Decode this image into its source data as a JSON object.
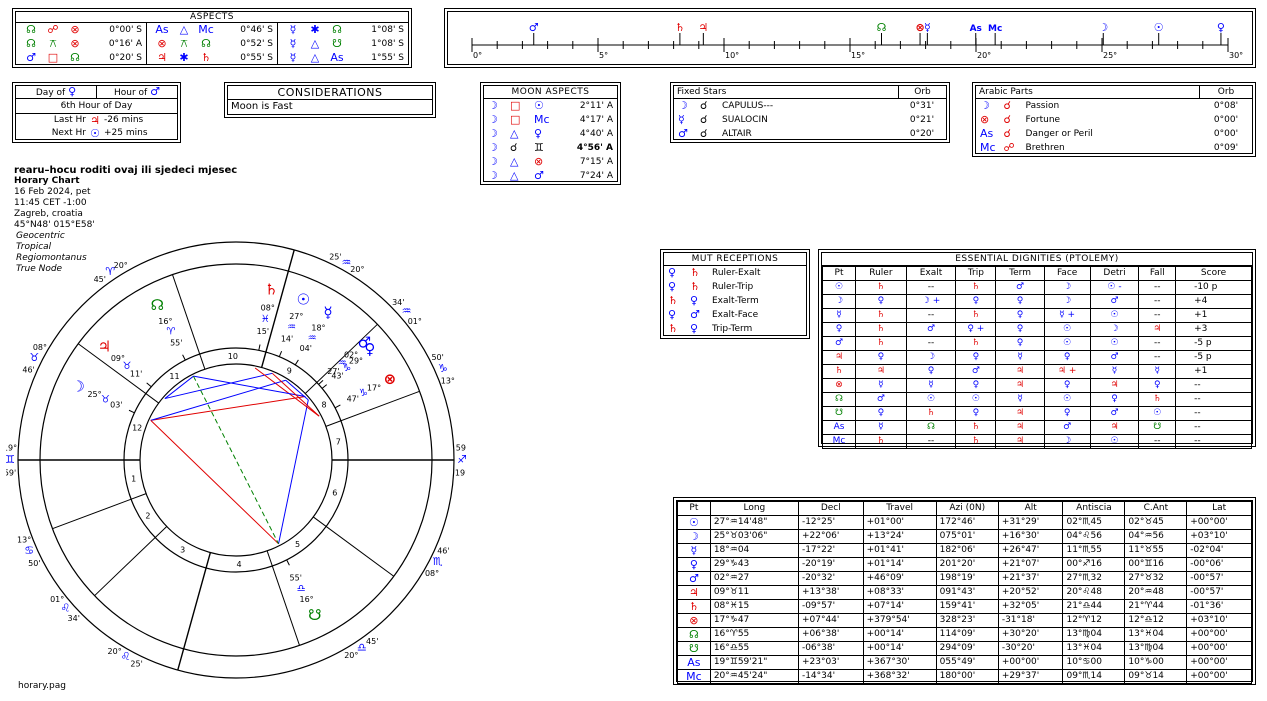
{
  "aspects": {
    "title": "ASPECTS",
    "groups": [
      [
        {
          "p1": "☊",
          "c1": "green",
          "asp": "☍",
          "ac": "red",
          "p2": "⊗",
          "c2": "red",
          "orb": "0°00' S"
        },
        {
          "p1": "☊",
          "c1": "green",
          "asp": "⚻",
          "ac": "green",
          "p2": "⊗",
          "c2": "red",
          "orb": "0°16' A"
        },
        {
          "p1": "♂",
          "c1": "blue",
          "asp": "□",
          "ac": "red",
          "p2": "☊",
          "c2": "green",
          "orb": "0°20' S"
        }
      ],
      [
        {
          "p1": "As",
          "c1": "blue",
          "asp": "△",
          "ac": "blue",
          "p2": "Mc",
          "c2": "blue",
          "orb": "0°46' S"
        },
        {
          "p1": "⊗",
          "c1": "red",
          "asp": "⚻",
          "ac": "green",
          "p2": "☊",
          "c2": "green",
          "orb": "0°52' S"
        },
        {
          "p1": "♃",
          "c1": "red",
          "asp": "✱",
          "ac": "blue",
          "p2": "♄",
          "c2": "red",
          "orb": "0°55' S"
        }
      ],
      [
        {
          "p1": "☿",
          "c1": "blue",
          "asp": "✱",
          "ac": "blue",
          "p2": "☊",
          "c2": "green",
          "orb": "1°08' S"
        },
        {
          "p1": "☿",
          "c1": "blue",
          "asp": "△",
          "ac": "blue",
          "p2": "☋",
          "c2": "green",
          "orb": "1°08' S"
        },
        {
          "p1": "☿",
          "c1": "blue",
          "asp": "△",
          "ac": "blue",
          "p2": "As",
          "c2": "blue",
          "orb": "1°55' S"
        }
      ]
    ]
  },
  "ruler": {
    "ticks": [
      "0°",
      "5°",
      "10°",
      "15°",
      "20°",
      "25°",
      "30°"
    ],
    "markers": [
      {
        "glyph": "♂",
        "deg": 2.45,
        "color": "#0000ff"
      },
      {
        "glyph": "♄",
        "deg": 8.25,
        "color": "#e00000"
      },
      {
        "glyph": "♃",
        "deg": 9.18,
        "color": "#e00000"
      },
      {
        "glyph": "☊",
        "deg": 16.25,
        "color": "#008000"
      },
      {
        "glyph": "⊗",
        "deg": 17.78,
        "color": "#e00000"
      },
      {
        "glyph": "☿",
        "deg": 18.07,
        "color": "#0000ff"
      },
      {
        "glyph": "As",
        "deg": 19.99,
        "color": "#0000ff"
      },
      {
        "glyph": "Mc",
        "deg": 20.76,
        "color": "#0000ff"
      },
      {
        "glyph": "☽",
        "deg": 25.05,
        "color": "#0000ff"
      },
      {
        "glyph": "☉",
        "deg": 27.25,
        "color": "#0000ff"
      },
      {
        "glyph": "♀",
        "deg": 29.72,
        "color": "#0000ff"
      }
    ]
  },
  "day_hour": {
    "day_of_label": "Day of",
    "day_planet": "♀",
    "hour_of_label": "Hour of",
    "hour_planet": "♂",
    "hour_text": "6th Hour of Day",
    "last_label": "Last Hr",
    "last_planet": "♃",
    "last_val": "-26 mins",
    "next_label": "Next Hr",
    "next_planet": "☉",
    "next_val": "+25 mins"
  },
  "considerations": {
    "title": "CONSIDERATIONS",
    "items": [
      "Moon is Fast"
    ]
  },
  "moon_aspects": {
    "title": "MOON ASPECTS",
    "rows": [
      {
        "a": "☽",
        "asp": "□",
        "ac": "red",
        "p": "☉",
        "pc": "blue",
        "orb": "2°11' A",
        "bold": false
      },
      {
        "a": "☽",
        "asp": "□",
        "ac": "red",
        "p": "Mc",
        "pc": "blue",
        "orb": "4°17' A",
        "bold": false
      },
      {
        "a": "☽",
        "asp": "△",
        "ac": "blue",
        "p": "♀",
        "pc": "blue",
        "orb": "4°40' A",
        "bold": false
      },
      {
        "a": "☽",
        "asp": "☌",
        "ac": "black",
        "p": "♊",
        "pc": "black",
        "orb": "4°56' A",
        "bold": true
      },
      {
        "a": "☽",
        "asp": "△",
        "ac": "blue",
        "p": "⊗",
        "pc": "red",
        "orb": "7°15' A",
        "bold": false
      },
      {
        "a": "☽",
        "asp": "△",
        "ac": "blue",
        "p": "♂",
        "pc": "blue",
        "orb": "7°24' A",
        "bold": false
      }
    ]
  },
  "fixed_stars": {
    "title": "Fixed Stars",
    "orb_label": "Orb",
    "rows": [
      {
        "p": "☽",
        "asp": "☌",
        "name": "CAPULUS---",
        "orb": "0°31'"
      },
      {
        "p": "☿",
        "asp": "☌",
        "name": "SUALOCIN",
        "orb": "0°21'"
      },
      {
        "p": "♂",
        "asp": "☌",
        "name": "ALTAIR",
        "orb": "0°20'"
      }
    ]
  },
  "arabic_parts": {
    "title": "Arabic Parts",
    "orb_label": "Orb",
    "rows": [
      {
        "p": "☽",
        "pc": "blue",
        "asp": "☌",
        "name": "Passion",
        "orb": "0°08'"
      },
      {
        "p": "⊗",
        "pc": "red",
        "asp": "☌",
        "name": "Fortune",
        "orb": "0°00'"
      },
      {
        "p": "As",
        "pc": "blue",
        "asp": "☌",
        "name": "Danger or Peril",
        "orb": "0°00'"
      },
      {
        "p": "Mc",
        "pc": "blue",
        "asp": "☍",
        "name": "Brethren",
        "orb": "0°09'"
      }
    ]
  },
  "header": {
    "question": "rearu–hocu roditi ovaj ili sjedeci mjesec",
    "chart_type": "Horary Chart",
    "date": "16 Feb 2024, pet",
    "time": "11:45  CET  -1:00",
    "place": "Zagreb, croatia",
    "coords": "45°N48' 015°E58'",
    "settings": [
      "Geocentric",
      "Tropical",
      "Regiomontanus",
      "True Node"
    ]
  },
  "mut_receptions": {
    "title": "MUT  RECEPTIONS",
    "rows": [
      {
        "a": "♀",
        "ac": "blue",
        "b": "♄",
        "bc": "red",
        "t": "Ruler-Exalt"
      },
      {
        "a": "♀",
        "ac": "blue",
        "b": "♄",
        "bc": "red",
        "t": "Ruler-Trip"
      },
      {
        "a": "♄",
        "ac": "red",
        "b": "♀",
        "bc": "blue",
        "t": "Exalt-Term"
      },
      {
        "a": "♀",
        "ac": "blue",
        "b": "♂",
        "bc": "blue",
        "t": "Exalt-Face"
      },
      {
        "a": "♄",
        "ac": "red",
        "b": "♀",
        "bc": "blue",
        "t": "Trip-Term"
      }
    ]
  },
  "dignities": {
    "title": "ESSENTIAL DIGNITIES (PTOLEMY)",
    "headers": [
      "Pt",
      "Ruler",
      "Exalt",
      "Trip",
      "Term",
      "Face",
      "Detri",
      "Fall",
      "Score"
    ],
    "rows": [
      [
        "☉",
        "♄",
        "--",
        "♄",
        "♂",
        "☽",
        "☉ -",
        "--",
        "-10  p"
      ],
      [
        "☽",
        "♀",
        "☽ +",
        "♀",
        "♀",
        "☽",
        "♂",
        "--",
        "+4"
      ],
      [
        "☿",
        "♄",
        "--",
        "♄",
        "♀",
        "☿ +",
        "☉",
        "--",
        "+1"
      ],
      [
        "♀",
        "♄",
        "♂",
        "♀ +",
        "♀",
        "☉",
        "☽",
        "♃",
        "+3"
      ],
      [
        "♂",
        "♄",
        "--",
        "♄",
        "♀",
        "☉",
        "☉",
        "--",
        "-5  p"
      ],
      [
        "♃",
        "♀",
        "☽",
        "♀",
        "☿",
        "♀",
        "♂",
        "--",
        "-5  p"
      ],
      [
        "♄",
        "♃",
        "♀",
        "♂",
        "♃",
        "♃ +",
        "☿",
        "☿",
        "+1"
      ],
      [
        "⊗",
        "☿",
        "☿",
        "♀",
        "♃",
        "♀",
        "♃",
        "♀",
        "--"
      ],
      [
        "☊",
        "♂",
        "☉",
        "☉",
        "☿",
        "☉",
        "♀",
        "♄",
        "--"
      ],
      [
        "☋",
        "♀",
        "♄",
        "♀",
        "♃",
        "♀",
        "♂",
        "☉",
        "--"
      ],
      [
        "As",
        "☿",
        "☊",
        "♄",
        "♃",
        "♂",
        "♃",
        "☋",
        "--"
      ],
      [
        "Mc",
        "♄",
        "--",
        "♄",
        "♃",
        "☽",
        "☉",
        "--",
        "--"
      ]
    ]
  },
  "positions": {
    "headers": [
      "Pt",
      "Long",
      "Decl",
      "Travel",
      "Azi (0N)",
      "Alt",
      "Antiscia",
      "C.Ant",
      "Lat"
    ],
    "rows": [
      [
        "☉",
        "27°♒14'48\"",
        "-12°25'",
        "+01°00'",
        "172°46'",
        "+31°29'",
        "02°♏45",
        "02°♉45",
        "+00°00'"
      ],
      [
        "☽",
        "25°♉03'06\"",
        "+22°06'",
        "+13°24'",
        "075°01'",
        "+16°30'",
        "04°♌56",
        "04°♒56",
        "+03°10'"
      ],
      [
        "☿",
        "18°♒04",
        "-17°22'",
        "+01°41'",
        "182°06'",
        "+26°47'",
        "11°♏55",
        "11°♉55",
        "-02°04'"
      ],
      [
        "♀",
        "29°♑43",
        "-20°19'",
        "+01°14'",
        "201°20'",
        "+21°07'",
        "00°♐16",
        "00°♊16",
        "-00°06'"
      ],
      [
        "♂",
        "02°♒27",
        "-20°32'",
        "+46°09'",
        "198°19'",
        "+21°37'",
        "27°♏32",
        "27°♉32",
        "-00°57'"
      ],
      [
        "♃",
        "09°♉11",
        "+13°38'",
        "+08°33'",
        "091°43'",
        "+20°52'",
        "20°♌48",
        "20°♒48",
        "-00°57'"
      ],
      [
        "♄",
        "08°♓15",
        "-09°57'",
        "+07°14'",
        "159°41'",
        "+32°05'",
        "21°♎44",
        "21°♈44",
        "-01°36'"
      ],
      [
        "⊗",
        "17°♑47",
        "+07°44'",
        "+379°54'",
        "328°23'",
        "-31°18'",
        "12°♈12",
        "12°♎12",
        "+03°10'"
      ],
      [
        "☊",
        "16°♈55",
        "+06°38'",
        "+00°14'",
        "114°09'",
        "+30°20'",
        "13°♍04",
        "13°♓04",
        "+00°00'"
      ],
      [
        "☋",
        "16°♎55",
        "-06°38'",
        "+00°14'",
        "294°09'",
        "-30°20'",
        "13°♓04",
        "13°♍04",
        "+00°00'"
      ],
      [
        "As",
        "19°♊59'21\"",
        "+23°03'",
        "+367°30'",
        "055°49'",
        "+00°00'",
        "10°♋00",
        "10°♑00",
        "+00°00'"
      ],
      [
        "Mc",
        "20°♒45'24\"",
        "-14°34'",
        "+368°32'",
        "180°00'",
        "+29°37'",
        "09°♏14",
        "09°♉14",
        "+00°00'"
      ]
    ]
  },
  "wheel": {
    "asc_deg": 79.99,
    "cusps": [
      79.99,
      100.5,
      123.8,
      154.5,
      188.9,
      223.6,
      259.99,
      280.5,
      303.8,
      334.5,
      8.9,
      43.6
    ],
    "house_numbers": [
      "1",
      "2",
      "3",
      "4",
      "5",
      "6",
      "7",
      "8",
      "9",
      "10",
      "11",
      "12"
    ],
    "cusp_labels": [
      {
        "lon": 79.99,
        "deg": "19°",
        "sign": "♊",
        "min": "59'"
      },
      {
        "lon": 259.99,
        "deg": "19°",
        "sign": "♐",
        "min": "59'"
      },
      {
        "lon": 320.75,
        "deg": "20°",
        "sign": "♒",
        "min": "25'"
      },
      {
        "lon": 140.75,
        "deg": "20°",
        "sign": "♌",
        "min": "25'"
      },
      {
        "lon": 23.8,
        "deg": "20°",
        "sign": "♈",
        "min": "45'"
      },
      {
        "lon": 203.8,
        "deg": "20°",
        "sign": "♎",
        "min": "45'"
      },
      {
        "lon": 53.2,
        "deg": "08°",
        "sign": "♉",
        "min": "46'"
      },
      {
        "lon": 233.2,
        "deg": "08°",
        "sign": "♏",
        "min": "46'"
      },
      {
        "lon": 103.8,
        "deg": "13°",
        "sign": "♋",
        "min": "50'"
      },
      {
        "lon": 283.8,
        "deg": "13°",
        "sign": "♑",
        "min": "50'"
      },
      {
        "lon": 121.0,
        "deg": "01°",
        "sign": "♌",
        "min": "34'"
      },
      {
        "lon": 301.0,
        "deg": "01°",
        "sign": "♒",
        "min": "34'"
      }
    ],
    "planets": [
      {
        "glyph": "☉",
        "lon": 327.25,
        "color": "#0000ff",
        "deg": "27°",
        "sign": "♒",
        "min": "14'"
      },
      {
        "glyph": "☿",
        "lon": 318.07,
        "color": "#0000ff",
        "deg": "18°",
        "sign": "♒",
        "min": "04'"
      },
      {
        "glyph": "♂",
        "lon": 302.45,
        "color": "#0000ff",
        "deg": "02°",
        "sign": "♒",
        "min": "27'"
      },
      {
        "glyph": "♀",
        "lon": 299.72,
        "color": "#0000ff",
        "deg": "29°",
        "sign": "♑",
        "min": "43'"
      },
      {
        "glyph": "♄",
        "lon": 338.25,
        "color": "#e00000",
        "deg": "08°",
        "sign": "♓",
        "min": "15'"
      },
      {
        "glyph": "☊",
        "lon": 16.9,
        "color": "#008000",
        "deg": "16°",
        "sign": "♈",
        "min": "55'"
      },
      {
        "glyph": "♃",
        "lon": 39.18,
        "color": "#e00000",
        "deg": "09°",
        "sign": "♉",
        "min": "11'"
      },
      {
        "glyph": "☽",
        "lon": 55.05,
        "color": "#0000ff",
        "deg": "25°",
        "sign": "♉",
        "min": "03'"
      },
      {
        "glyph": "☋",
        "lon": 196.9,
        "color": "#008000",
        "deg": "16°",
        "sign": "♎",
        "min": "55'"
      },
      {
        "glyph": "⊗",
        "lon": 287.78,
        "color": "#e00000",
        "deg": "17°",
        "sign": "♑",
        "min": "47'"
      }
    ],
    "footer": "horary.pag"
  }
}
